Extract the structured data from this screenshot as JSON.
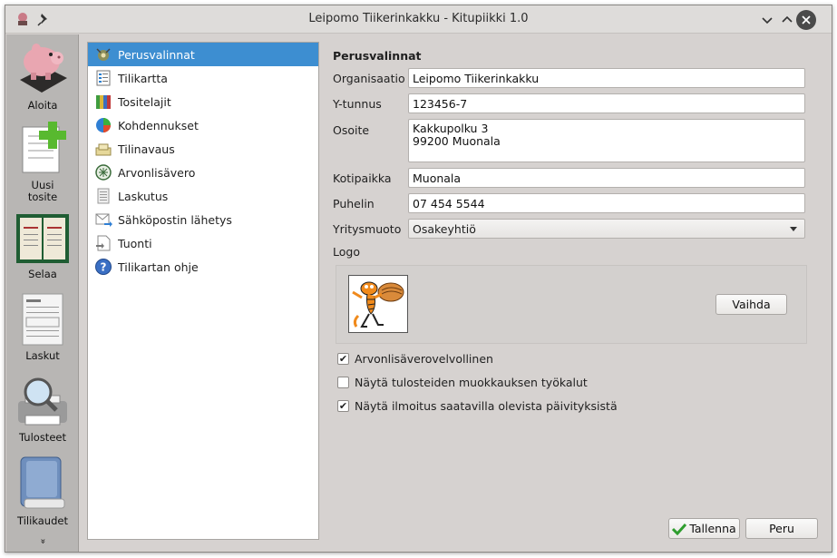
{
  "window": {
    "title": "Leipomo Tiikerinkakku - Kitupiikki 1.0"
  },
  "toolbar": {
    "items": [
      {
        "label": "Aloita",
        "icon": "piggy-bank-icon"
      },
      {
        "label": "Uusi\ntosite",
        "icon": "new-document-icon"
      },
      {
        "label": "Selaa",
        "icon": "ledger-book-icon"
      },
      {
        "label": "Laskut",
        "icon": "invoice-icon"
      },
      {
        "label": "Tulosteet",
        "icon": "printer-magnifier-icon"
      },
      {
        "label": "Tilikaudet",
        "icon": "book-icon"
      }
    ],
    "more": "»"
  },
  "list": {
    "items": [
      {
        "label": "Perusvalinnat",
        "icon": "settings-icon",
        "selected": true
      },
      {
        "label": "Tilikartta",
        "icon": "chart-of-accounts-icon"
      },
      {
        "label": "Tositelajit",
        "icon": "binders-icon"
      },
      {
        "label": "Kohdennukset",
        "icon": "pie-chart-icon"
      },
      {
        "label": "Tilinavaus",
        "icon": "cash-icon"
      },
      {
        "label": "Arvonlisävero",
        "icon": "tax-seal-icon"
      },
      {
        "label": "Laskutus",
        "icon": "bill-icon"
      },
      {
        "label": "Sähköpostin lähetys",
        "icon": "email-send-icon"
      },
      {
        "label": "Tuonti",
        "icon": "import-icon"
      },
      {
        "label": "Tilikartan ohje",
        "icon": "help-icon"
      }
    ]
  },
  "form": {
    "heading": "Perusvalinnat",
    "organisaatio_label": "Organisaatio",
    "organisaatio_value": "Leipomo Tiikerinkakku",
    "ytunnus_label": "Y-tunnus",
    "ytunnus_value": "123456-7",
    "osoite_label": "Osoite",
    "osoite_value": "Kakkupolku 3\n99200 Muonala",
    "kotipaikka_label": "Kotipaikka",
    "kotipaikka_value": "Muonala",
    "puhelin_label": "Puhelin",
    "puhelin_value": "07 454 5544",
    "yritysmuoto_label": "Yritysmuoto",
    "yritysmuoto_value": "Osakeyhtiö",
    "logo_label": "Logo",
    "vaihda_label": "Vaihda",
    "checks": [
      {
        "label": "Arvonlisäverovelvollinen",
        "checked": true
      },
      {
        "label": "Näytä tulosteiden muokkauksen työkalut",
        "checked": false
      },
      {
        "label": "Näytä ilmoitus saatavilla olevista päivityksistä",
        "checked": true
      }
    ],
    "save_label": "Tallenna",
    "cancel_label": "Peru",
    "check_mark": "✔"
  },
  "colors": {
    "selection": "#3d8ed1",
    "save_check": "#2e9d2e"
  }
}
